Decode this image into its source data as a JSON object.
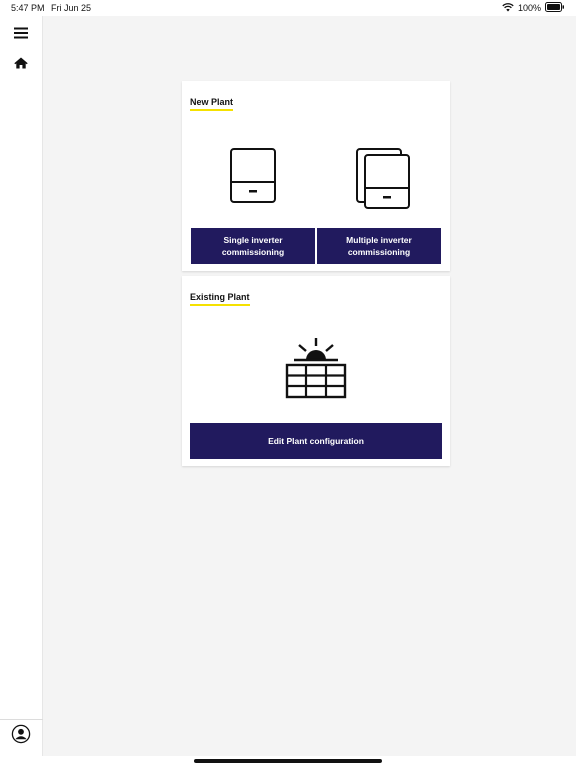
{
  "status_bar": {
    "time": "5:47 PM",
    "date": "Fri Jun 25",
    "battery": "100%",
    "icons": [
      "wifi-icon",
      "battery-icon"
    ]
  },
  "sidebar": {
    "items": [
      {
        "name": "menu",
        "icon": "hamburger-menu-icon"
      },
      {
        "name": "home",
        "icon": "home-icon"
      }
    ],
    "footer": {
      "icon": "user-profile-icon"
    }
  },
  "new_plant": {
    "title": "New Plant",
    "single": {
      "label": "Single inverter commissioning",
      "icon": "single-inverter-icon"
    },
    "multiple": {
      "label": "Multiple inverter commissioning",
      "icon": "multiple-inverter-icon"
    }
  },
  "existing_plant": {
    "title": "Existing Plant",
    "icon": "solar-panel-sun-icon",
    "edit": {
      "label": "Edit Plant configuration"
    }
  },
  "colors": {
    "primary_button": "#211a5e",
    "accent_underline": "#f5e100",
    "background": "#f4f4f4",
    "card": "#ffffff"
  }
}
